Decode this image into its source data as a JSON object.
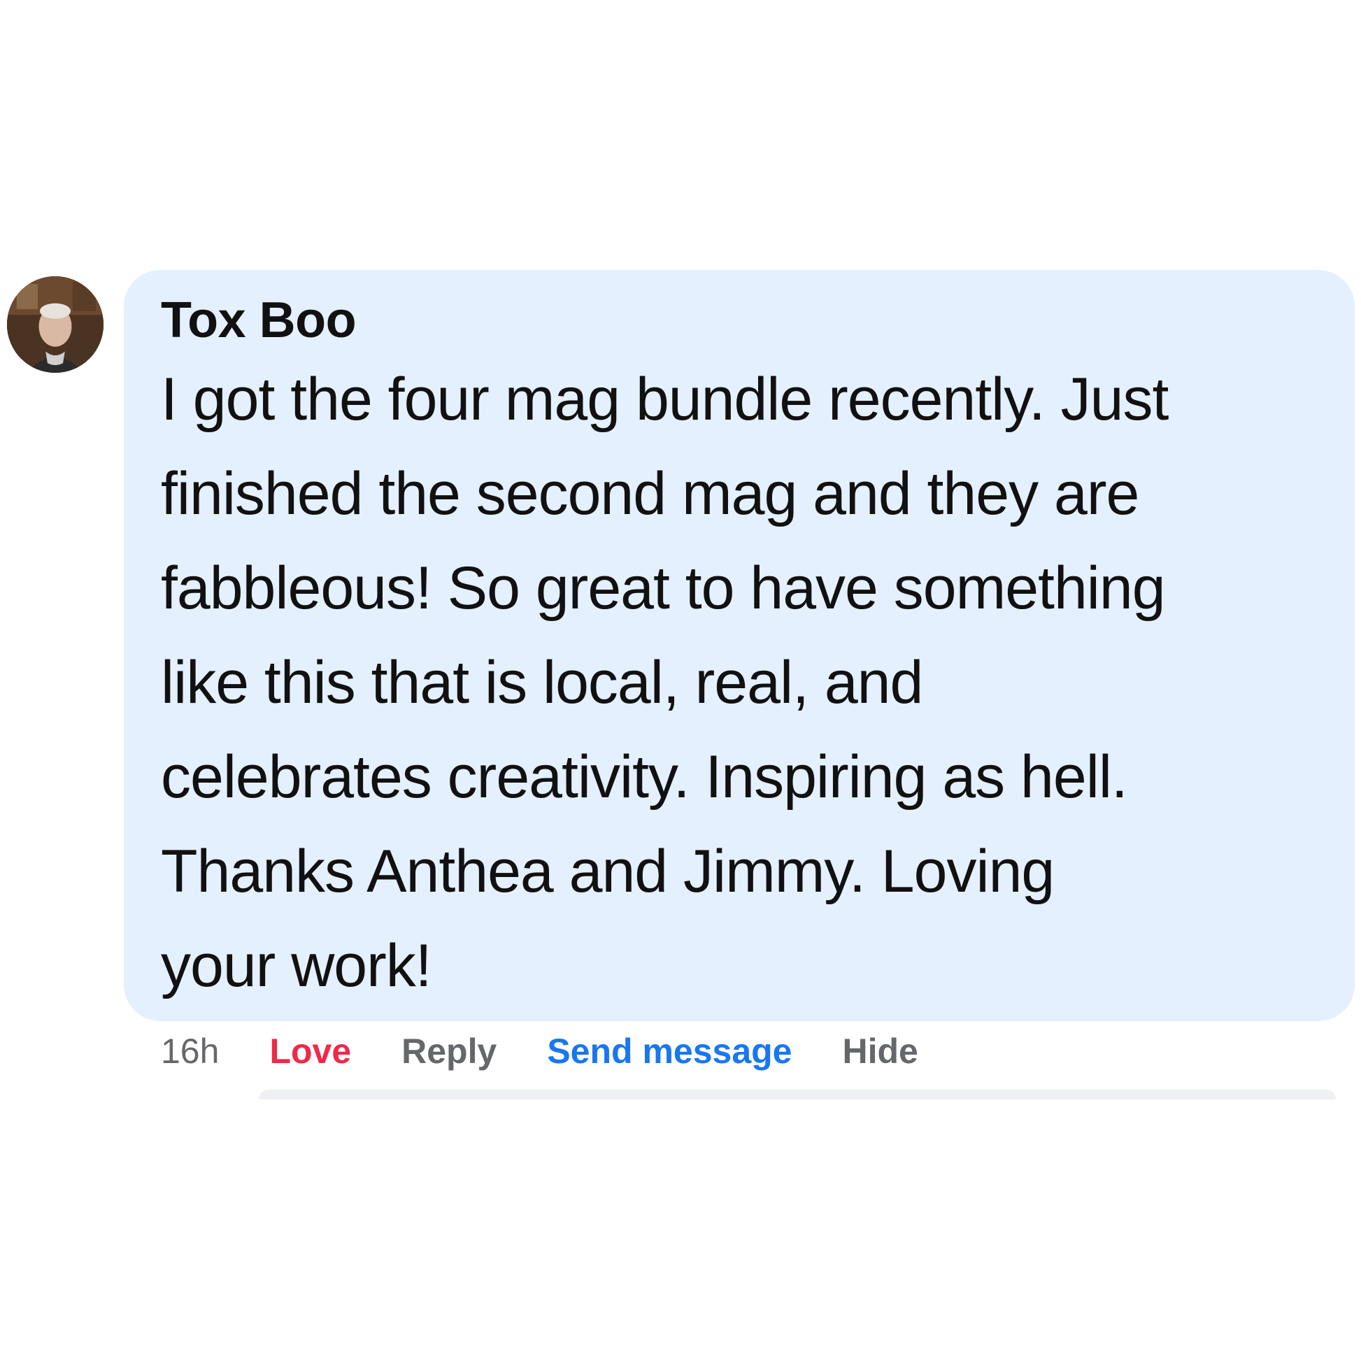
{
  "comment": {
    "author": "Tox Boo",
    "lines": [
      "I got the four mag bundle recently. Just",
      "finished the second mag and they are",
      "fabbleous! So great to have something",
      "like this that is local, real, and",
      "celebrates creativity. Inspiring as hell.",
      "Thanks Anthea and Jimmy. Loving",
      "your work!"
    ],
    "bubble_color": "#e4f0fe"
  },
  "actions": {
    "time": "16h",
    "love_label": "Love",
    "reply_label": "Reply",
    "send_message_label": "Send message",
    "hide_label": "Hide"
  },
  "colors": {
    "love": "#f02849",
    "link": "#1877f2",
    "muted": "#65676b"
  }
}
